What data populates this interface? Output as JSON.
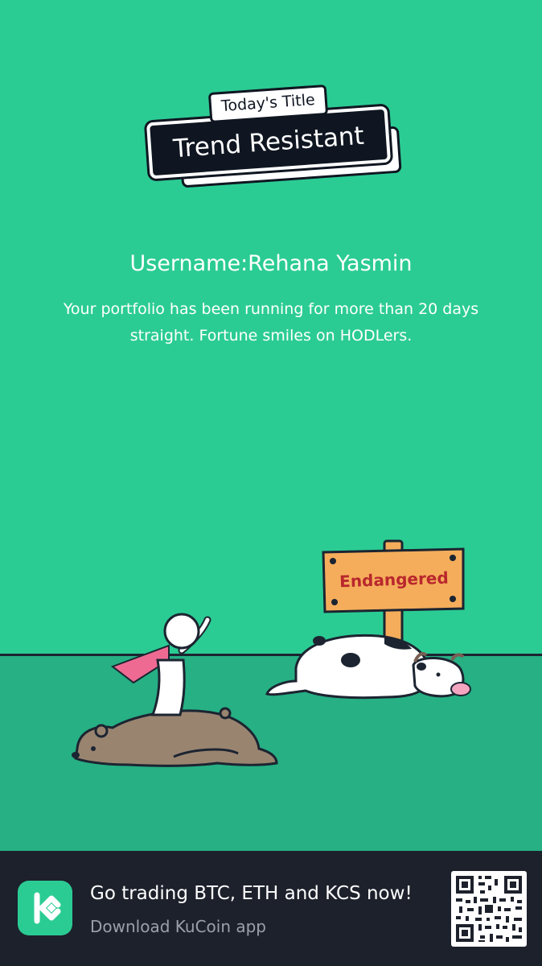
{
  "title_badge": {
    "small_label": "Today's Title",
    "main_title": "Trend Resistant"
  },
  "profile": {
    "username": "Username:Rehana Yasmin",
    "description": "Your portfolio has been running for more than 20 days straight. Fortune smiles on HODLers."
  },
  "illustration": {
    "sign_text": "Endangered"
  },
  "footer": {
    "headline": "Go trading BTC, ETH and KCS now!",
    "subline": "Download KuCoin app",
    "app_icon": "kucoin-logo-icon",
    "qr": "qr-code"
  },
  "colors": {
    "background": "#2bcc94",
    "ground": "#26b084",
    "footer": "#1d212c",
    "accent": "#2bcc94"
  }
}
